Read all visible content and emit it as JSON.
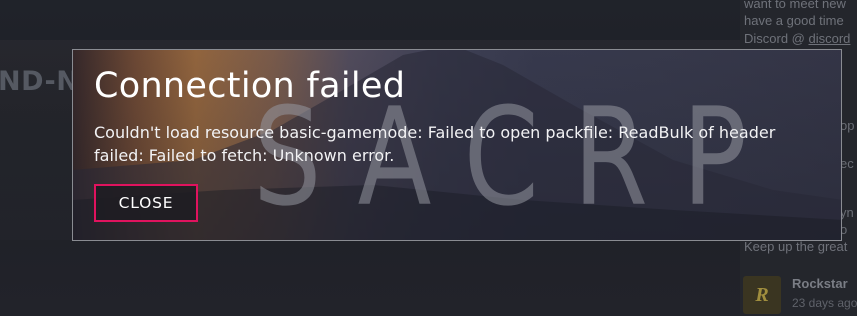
{
  "background": {
    "heading_partial": "ND-N",
    "sidebar": {
      "line1": "want to meet new",
      "line2": "have a good time",
      "line3_prefix": "Discord @ ",
      "line3_link": "discord",
      "partial_op": "op",
      "partial_ec": "ec",
      "partial_yn": "yn",
      "partial_o": "o",
      "line_keep": "Keep up the great",
      "author": "Rockstar",
      "date": "23 days ago"
    }
  },
  "modal": {
    "title": "Connection failed",
    "message": "Couldn't load resource basic-gamemode: Failed to open packfile: ReadBulk of header failed: Failed to fetch: Unknown error.",
    "watermark": "SACRP",
    "close_label": "CLOSE"
  },
  "colors": {
    "accent": "#e0135e",
    "modal_border": "#8a8c92"
  }
}
